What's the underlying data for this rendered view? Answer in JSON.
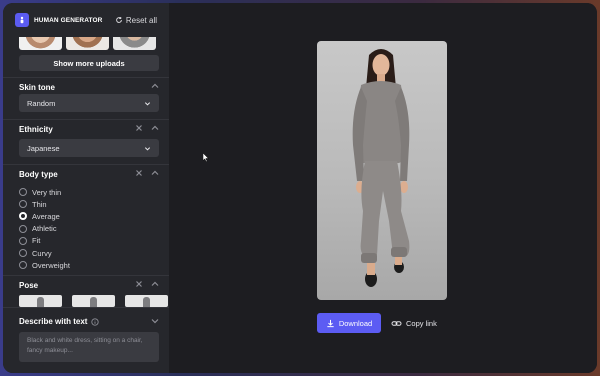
{
  "app": {
    "brand": "HUMAN GENERATOR",
    "reset_label": "Reset all"
  },
  "uploads": {
    "more_label": "Show more uploads"
  },
  "skin_tone": {
    "title": "Skin tone",
    "value": "Random"
  },
  "ethnicity": {
    "title": "Ethnicity",
    "value": "Japanese"
  },
  "body_type": {
    "title": "Body type",
    "options": [
      "Very thin",
      "Thin",
      "Average",
      "Athletic",
      "Fit",
      "Curvy",
      "Overweight"
    ],
    "selected": "Average"
  },
  "pose": {
    "title": "Pose"
  },
  "describe": {
    "title": "Describe with text",
    "placeholder": "Black and white dress, sitting on a chair, fancy makeup..."
  },
  "actions": {
    "download_label": "Download",
    "copy_label": "Copy link"
  },
  "colors": {
    "accent": "#5c5cf3",
    "sidebar": "#26272c",
    "main": "#1d1d21"
  }
}
